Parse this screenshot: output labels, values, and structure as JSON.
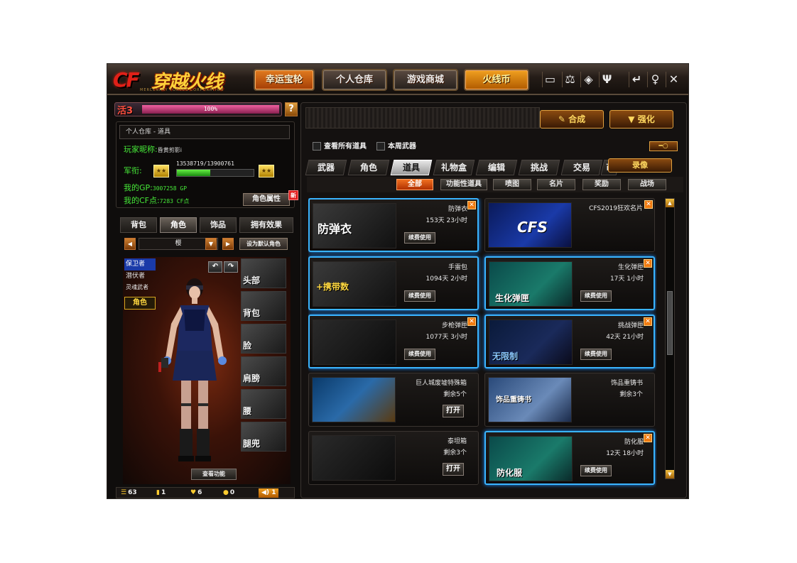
{
  "header": {
    "logo_cf": "CF",
    "logo_title": "穿越火线",
    "logo_sub": "MERCENARY FORCES CORPORATION",
    "nav": [
      "幸运宝轮",
      "个人仓库",
      "游戏商城",
      "火线币"
    ],
    "window_icons": [
      "tv-icon",
      "scale-icon",
      "shield-icon",
      "trophy-icon",
      "back-icon",
      "pin-icon",
      "close-icon"
    ]
  },
  "level": {
    "label": "活3",
    "percent_text": "100%",
    "progress": 1.0,
    "help": "?"
  },
  "info": {
    "breadcrumb": "个人仓库 - 道具",
    "nickname_label": "玩家昵称:",
    "nickname": "昏黄剪影i",
    "rank_label": "军衔:",
    "exp_text": "13538719/13900761",
    "exp_progress": 0.974,
    "gp_label": "我的GP:",
    "gp_value": "3007258 GP",
    "cf_label": "我的CF点:",
    "cf_value": "7283 CF点",
    "role_attr_button": "角色属性",
    "new_badge": "新"
  },
  "left_tabs": [
    "背包",
    "角色",
    "饰品",
    "拥有效果"
  ],
  "left_active_tab": 1,
  "role_select": {
    "value": "樱",
    "set_default": "设为默认角色"
  },
  "roles": {
    "list": [
      "保卫者",
      "潜伏者",
      "灵魂武者"
    ],
    "selected": 0,
    "tag": "角色"
  },
  "slots": [
    "头部",
    "背包",
    "脸",
    "肩膀",
    "腰",
    "腿兜"
  ],
  "view_func": "查看功能",
  "status": {
    "list_count": "63",
    "item2": "1",
    "item3": "6",
    "chat": "0",
    "speaker": "1"
  },
  "right": {
    "synthesize": "合成",
    "enhance": "强化",
    "filter_all": "查看所有道具",
    "filter_week": "本周武器",
    "key_icon": "key-icon",
    "tabs": [
      "武器",
      "角色",
      "道具",
      "礼物盒",
      "编辑",
      "挑战",
      "交易",
      "币"
    ],
    "active_tab": 2,
    "record": "录像",
    "sub_tabs": [
      "全部",
      "功能性道具",
      "喷图",
      "名片",
      "奖励",
      "战场"
    ],
    "active_sub_tab": 0
  },
  "items": [
    {
      "name": "防弹衣",
      "duration": "153天 23小时",
      "action": "续费使用",
      "thumb_label": "防弹衣",
      "closable": true,
      "highlight": true
    },
    {
      "name": "CFS2019狂欢名片",
      "duration": "",
      "action": "",
      "thumb_label": "CFS",
      "closable": true,
      "highlight": false
    },
    {
      "name": "手雷包",
      "duration": "1094天 2小时",
      "action": "续费使用",
      "thumb_label": "+携带数",
      "closable": false,
      "highlight": true
    },
    {
      "name": "生化弹匣",
      "duration": "17天 1小时",
      "action": "续费使用",
      "thumb_label": "生化弹匣",
      "closable": true,
      "highlight": true
    },
    {
      "name": "步枪弹匣",
      "duration": "1077天 3小时",
      "action": "续费使用",
      "thumb_label": "",
      "closable": true,
      "highlight": true
    },
    {
      "name": "挑战弹匣",
      "duration": "42天 21小时",
      "action": "续费使用",
      "thumb_label": "无限制",
      "closable": true,
      "highlight": true
    },
    {
      "name": "巨人城废墟特殊箱",
      "duration": "剩余5个",
      "action": "打开",
      "thumb_label": "",
      "closable": false,
      "highlight": false
    },
    {
      "name": "饰品重铸书",
      "duration": "剩余3个",
      "action": "",
      "thumb_label": "饰品重铸书",
      "closable": false,
      "highlight": false
    },
    {
      "name": "泰坦箱",
      "duration": "剩余3个",
      "action": "打开",
      "thumb_label": "",
      "closable": false,
      "highlight": false
    },
    {
      "name": "防化服",
      "duration": "12天 18小时",
      "action": "续费使用",
      "thumb_label": "防化服",
      "closable": true,
      "highlight": true
    }
  ]
}
